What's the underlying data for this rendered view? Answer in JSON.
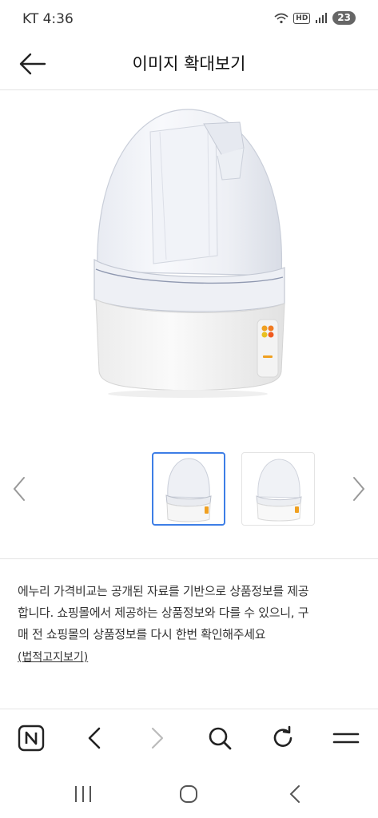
{
  "status_bar": {
    "time": "KT 4:36",
    "hd": "HD",
    "battery": "23"
  },
  "header": {
    "title": "이미지 확대보기",
    "back_icon": "arrow-left-icon"
  },
  "gallery": {
    "thumbnails": [
      {
        "selected": true
      },
      {
        "selected": false
      }
    ],
    "prev_icon": "chevron-left-icon",
    "next_icon": "chevron-right-icon"
  },
  "notice": {
    "line1": "에누리 가격비교는 공개된 자료를 기반으로 상품정보를 제공",
    "line2": "합니다. 쇼핑몰에서 제공하는 상품정보와 다를 수 있으니, 구",
    "line3": "매 전 쇼핑몰의 상품정보를 다시 한번 확인해주세요",
    "legal_link": "(법적고지보기)"
  },
  "toolbar": {
    "items": [
      "naver-icon",
      "back-icon",
      "forward-icon",
      "search-icon",
      "refresh-icon",
      "menu-icon"
    ]
  },
  "system_nav": {
    "items": [
      "recents-icon",
      "home-icon",
      "back-icon"
    ]
  },
  "colors": {
    "selected_border": "#3d7ee6",
    "divider": "#e5e5e5"
  }
}
